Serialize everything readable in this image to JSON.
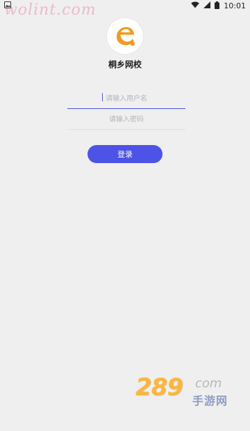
{
  "status_bar": {
    "time": "10:01",
    "icons": [
      "image-icon",
      "wifi-icon",
      "signal-icon",
      "battery-icon"
    ]
  },
  "watermark_top": "wolint.com",
  "app": {
    "logo_letter": "e",
    "title": "桐乡网校"
  },
  "form": {
    "username_placeholder": "请输入用户名",
    "password_placeholder": "请输入密码",
    "login_label": "登录"
  },
  "watermark_bottom": {
    "number": "289",
    "suffix": "com",
    "label": "手游网"
  },
  "colors": {
    "background": "#efeff0",
    "accent": "#4d53e6",
    "logo_orange": "#f39a22"
  }
}
